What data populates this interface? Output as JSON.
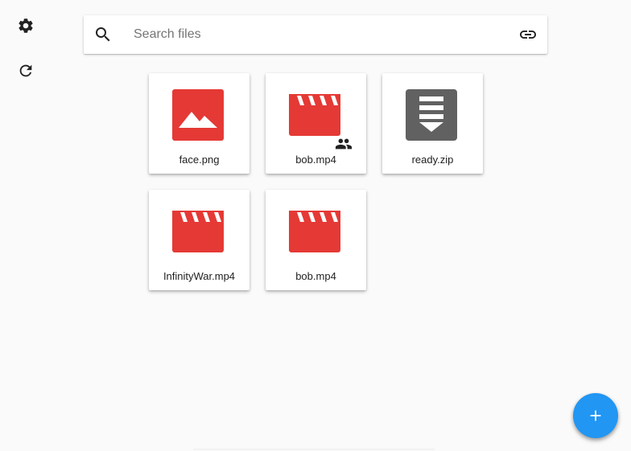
{
  "sidebar": {
    "settings_icon": "gear-icon",
    "refresh_icon": "refresh-icon"
  },
  "search": {
    "placeholder": "Search files",
    "value": "",
    "search_icon": "search-icon",
    "link_icon": "link-icon"
  },
  "files": [
    {
      "name": "face.png",
      "type": "image",
      "color": "#e53935",
      "shared": false
    },
    {
      "name": "bob.mp4",
      "type": "video",
      "color": "#e53935",
      "shared": true
    },
    {
      "name": "ready.zip",
      "type": "archive",
      "color": "#616161",
      "shared": false
    },
    {
      "name": "InfinityWar.mp4",
      "type": "video",
      "color": "#e53935",
      "shared": false
    },
    {
      "name": "bob.mp4",
      "type": "video",
      "color": "#e53935",
      "shared": false
    }
  ],
  "fab": {
    "icon": "plus-icon",
    "color": "#2196f3"
  }
}
